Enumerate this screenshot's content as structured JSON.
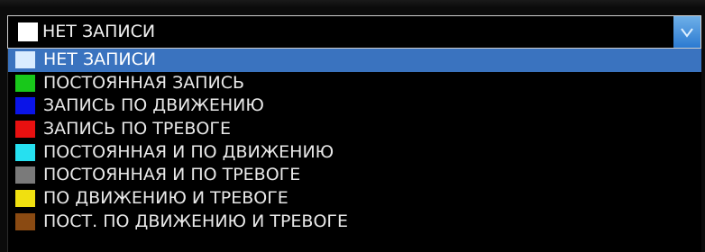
{
  "select": {
    "value": "НЕТ ЗАПИСИ",
    "value_color": "#ffffff"
  },
  "options": [
    {
      "label": "НЕТ ЗАПИСИ",
      "color": "#d9ecff",
      "selected": true
    },
    {
      "label": "ПОСТОЯННАЯ ЗАПИСЬ",
      "color": "#18c81a",
      "selected": false
    },
    {
      "label": "ЗАПИСЬ ПО ДВИЖЕНИЮ",
      "color": "#0a14e8",
      "selected": false
    },
    {
      "label": "ЗАПИСЬ ПО ТРЕВОГЕ",
      "color": "#e81010",
      "selected": false
    },
    {
      "label": "ПОСТОЯННАЯ И ПО ДВИЖЕНИЮ",
      "color": "#26e0f0",
      "selected": false
    },
    {
      "label": "ПОСТОЯННАЯ И ПО ТРЕВОГЕ",
      "color": "#7a7a7a",
      "selected": false
    },
    {
      "label": "ПО ДВИЖЕНИЮ И ТРЕВОГЕ",
      "color": "#f0e010",
      "selected": false
    },
    {
      "label": "ПОСТ. ПО ДВИЖЕНИЮ И ТРЕВОГЕ",
      "color": "#8a4a12",
      "selected": false
    }
  ],
  "colors": {
    "selection_highlight": "#3a73bf",
    "background": "#000000",
    "text": "#e9e9e9"
  },
  "icons": {
    "dropdown_arrow": "chevron-down-icon"
  }
}
